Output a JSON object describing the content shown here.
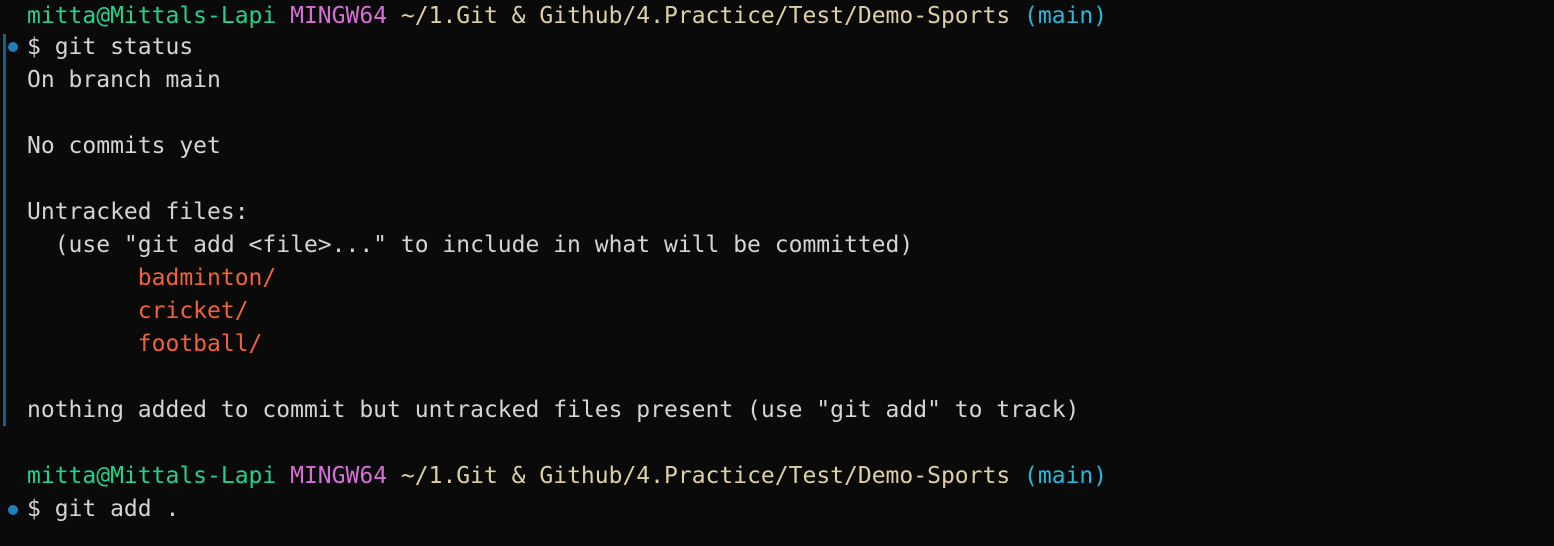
{
  "colors": {
    "background": "#0a0a0a",
    "text": "#d4d4d4",
    "user_host": "#23d18b",
    "shell": "#d670d6",
    "path": "#dcc77a",
    "branch": "#29b8db",
    "untracked_file": "#f0633a",
    "decoration": "#1f7fb8"
  },
  "prompts": [
    {
      "user": "mitta@Mittals-Lapi",
      "shell": "MINGW64",
      "path": "~/1.Git & Github/4.Practice/Test/Demo-Sports",
      "branch": "(main)",
      "command": "$ git status"
    },
    {
      "user": "mitta@Mittals-Lapi",
      "shell": "MINGW64",
      "path": "~/1.Git & Github/4.Practice/Test/Demo-Sports",
      "branch": "(main)",
      "command": "$ git add ."
    }
  ],
  "output": {
    "branch_line": "On branch main",
    "commits_line": "No commits yet",
    "untracked_header": "Untracked files:",
    "untracked_hint": "  (use \"git add <file>...\" to include in what will be committed)",
    "untracked_files": [
      "        badminton/",
      "        cricket/",
      "        football/"
    ],
    "summary": "nothing added to commit but untracked files present (use \"git add\" to track)"
  }
}
